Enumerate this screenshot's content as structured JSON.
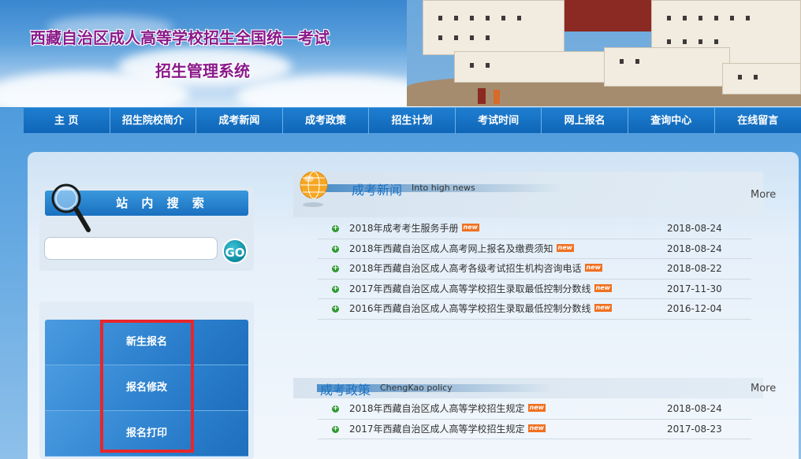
{
  "header": {
    "title_line1": "西藏自治区成人高等学校招生全国统一考试",
    "title_line2": "招生管理系统"
  },
  "nav": {
    "items": [
      "主 页",
      "招生院校简介",
      "成考新闻",
      "成考政策",
      "招生计划",
      "考试时间",
      "网上报名",
      "查询中心",
      "在线留言"
    ]
  },
  "search": {
    "title": "站 内 搜 索",
    "placeholder": "",
    "go_label": "GO"
  },
  "menu": {
    "items": [
      "新生报名",
      "报名修改",
      "报名打印"
    ]
  },
  "news": {
    "title": "成考新闻",
    "subtitle": "Into high news",
    "more": "More",
    "badge": "new",
    "rows": [
      {
        "text": "2018年成考考生服务手册",
        "date": "2018-08-24"
      },
      {
        "text": "2018年西藏自治区成人高考网上报名及缴费须知",
        "date": "2018-08-24"
      },
      {
        "text": "2018年西藏自治区成人高考各级考试招生机构咨询电话",
        "date": "2018-08-22"
      },
      {
        "text": "2017年西藏自治区成人高等学校招生录取最低控制分数线",
        "date": "2017-11-30"
      },
      {
        "text": "2016年西藏自治区成人高等学校招生录取最低控制分数线",
        "date": "2016-12-04"
      }
    ]
  },
  "policy": {
    "title": "成考政策",
    "subtitle": "ChengKao policy",
    "more": "More",
    "badge": "new",
    "rows": [
      {
        "text": "2018年西藏自治区成人高等学校招生规定",
        "date": "2018-08-24"
      },
      {
        "text": "2017年西藏自治区成人高等学校招生规定",
        "date": "2017-08-23"
      }
    ]
  },
  "colors": {
    "nav_blue": "#0f66b8",
    "title_purple": "#8a1a8a",
    "highlight_red": "#e8262b",
    "new_badge": "#f07020"
  }
}
